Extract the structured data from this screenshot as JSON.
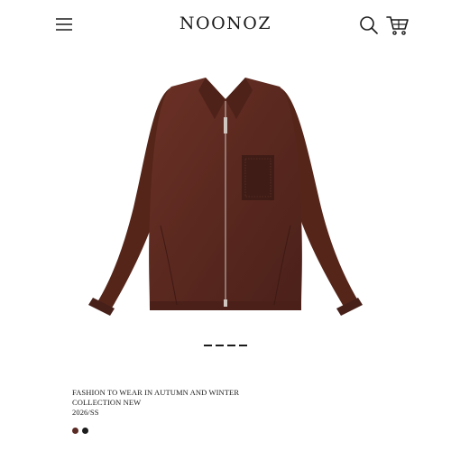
{
  "header": {
    "brand": "NOONOZ",
    "menu_icon": "hamburger-menu-icon",
    "search_icon": "search-icon",
    "cart_icon": "shopping-cart-icon"
  },
  "product": {
    "image_icon": "jacket-image",
    "title_line1": "FASHION TO WEAR IN AUTUMN AND WINTER",
    "title_line2": "COLLECTION NEW",
    "season": "2026/SS",
    "colors": [
      "#5a2b25",
      "#1c1c1c"
    ],
    "jacket_color": "#5c2a22"
  },
  "carousel": {
    "slide_count": 4
  }
}
